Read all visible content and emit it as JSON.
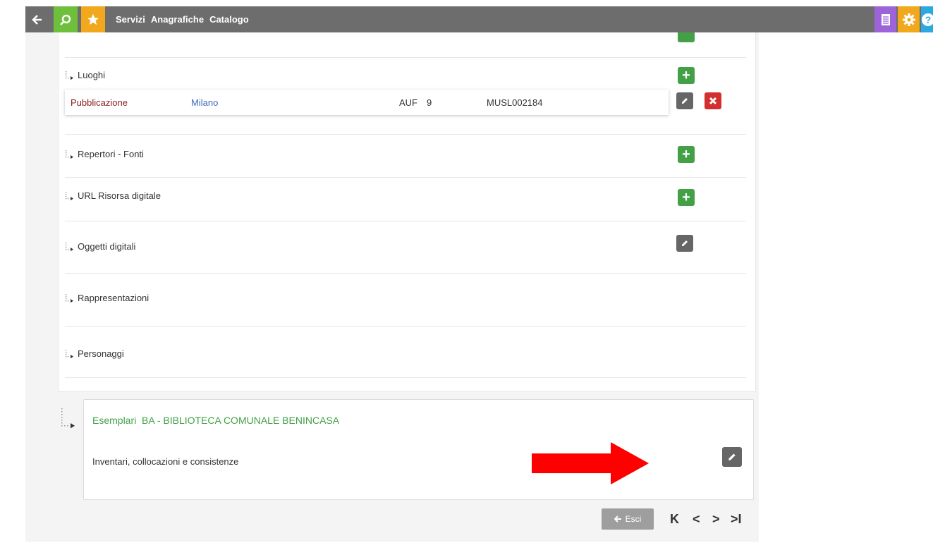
{
  "topbar": {
    "menu": [
      "Servizi",
      "Anagrafiche",
      "Catalogo"
    ],
    "colors": {
      "bar": "#6d6d6d",
      "back": "#6d6d6d",
      "search": "#6dbf3c",
      "star": "#f2a81d",
      "doc": "#9c64d8",
      "gear": "#f2a81d",
      "help": "#2ba9e0"
    }
  },
  "sections": [
    {
      "label": "Luoghi",
      "add": true
    },
    {
      "label": "Repertori - Fonti",
      "add": true
    },
    {
      "label": "URL Risorsa digitale",
      "add": true
    },
    {
      "label": "Oggetti digitali",
      "edit": true
    },
    {
      "label": "Rappresentazioni"
    },
    {
      "label": "Personaggi"
    }
  ],
  "luoghi_row": {
    "role": "Pubblicazione",
    "place": "Milano",
    "type": "AUF",
    "level": "9",
    "code": "MUSL002184"
  },
  "esemplari": {
    "title": "Esemplari  BA - BIBLIOTECA COMUNALE BENINCASA",
    "subtitle": "Inventari, collocazioni e consistenze"
  },
  "footer": {
    "exit_label": "Esci",
    "pager": [
      "K",
      "<",
      ">",
      ">I"
    ]
  },
  "annotation": {
    "arrow_color": "#ff0000"
  }
}
